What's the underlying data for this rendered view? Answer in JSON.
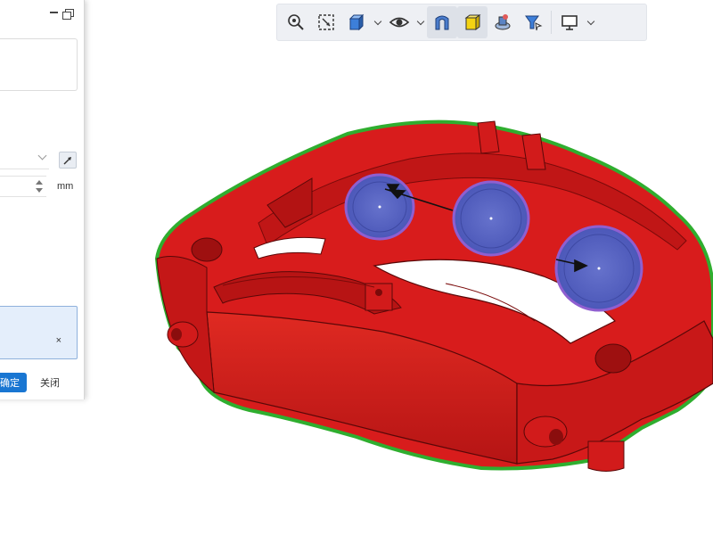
{
  "panel": {
    "units": "mm",
    "ok_label": "确定",
    "close_label": "关闭",
    "clear_symbol": "×"
  },
  "toolbar": {
    "tools": [
      {
        "icon": "zoom-icon"
      },
      {
        "icon": "zoom-window-icon"
      },
      {
        "icon": "view-cube-icon",
        "dropdown": true
      },
      {
        "icon": "visibility-eye-icon",
        "dropdown": true
      },
      {
        "icon": "section-view-icon"
      },
      {
        "icon": "shaded-display-icon",
        "active": true
      },
      {
        "icon": "appearance-icon"
      },
      {
        "icon": "selection-filter-icon"
      },
      {
        "icon": "display-settings-icon",
        "dropdown": true
      }
    ]
  },
  "model": {
    "part": "brake caliper",
    "body_color": "#d81c1c",
    "outline_color": "#2fae2f",
    "highlight_color": "#6f7bd8"
  }
}
